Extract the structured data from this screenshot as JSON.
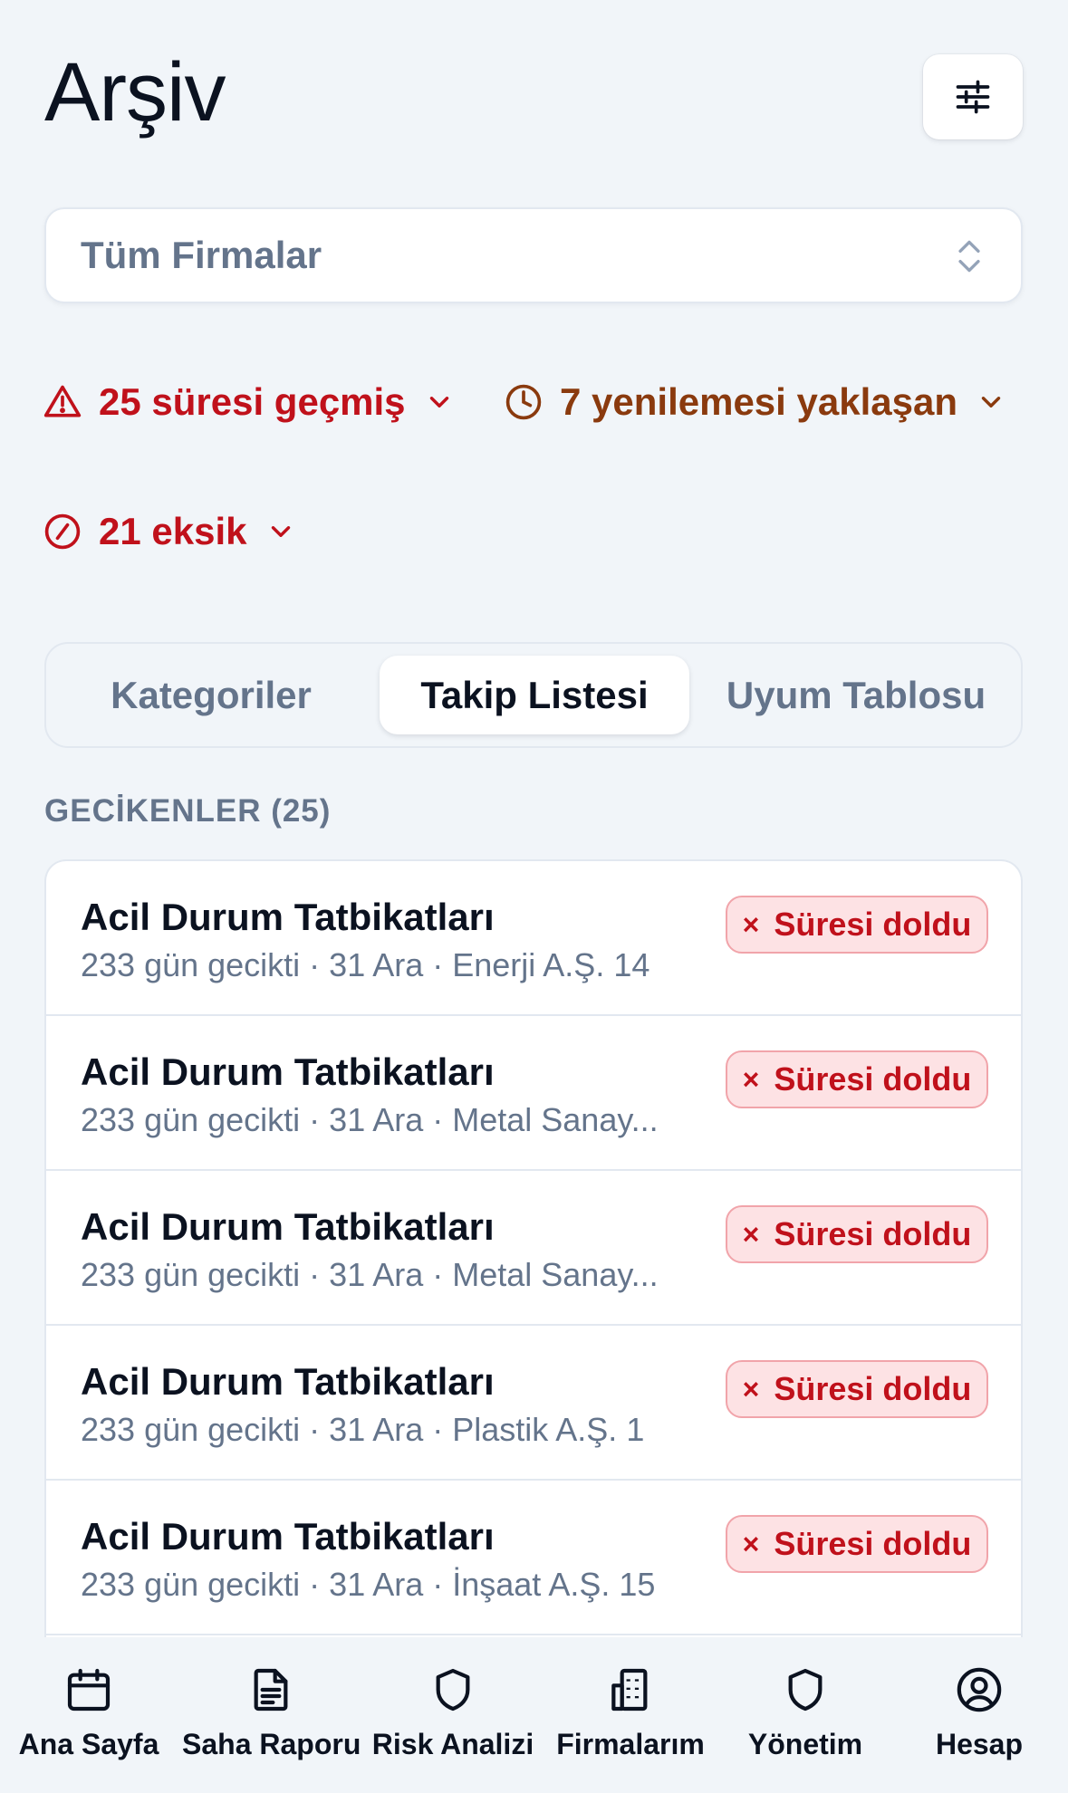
{
  "header": {
    "title": "Arşiv",
    "filter_icon": "sliders-icon"
  },
  "company_select": {
    "value": "Tüm Firmalar",
    "icon": "chevron-up-down-icon"
  },
  "alerts": {
    "overdue": {
      "label": "25 süresi geçmiş",
      "icon": "warning-triangle-icon",
      "color": "#c0111b"
    },
    "upcoming": {
      "label": "7 yenilemesi yaklaşan",
      "icon": "clock-icon",
      "color": "#8a3a0e"
    },
    "missing": {
      "label": "21 eksik",
      "icon": "ban-icon",
      "color": "#c0111b"
    }
  },
  "tabs": [
    {
      "label": "Kategoriler",
      "active": false
    },
    {
      "label": "Takip Listesi",
      "active": true
    },
    {
      "label": "Uyum Tablosu",
      "active": false
    }
  ],
  "section": {
    "label": "GECİKENLER (25)"
  },
  "items": [
    {
      "title": "Acil Durum Tatbikatları",
      "subtitle": "233 gün gecikti · 31 Ara · Enerji A.Ş. 14",
      "badge": "Süresi doldu",
      "badge_icon": "×"
    },
    {
      "title": "Acil Durum Tatbikatları",
      "subtitle": "233 gün gecikti · 31 Ara · Metal Sanay...",
      "badge": "Süresi doldu",
      "badge_icon": "×"
    },
    {
      "title": "Acil Durum Tatbikatları",
      "subtitle": "233 gün gecikti · 31 Ara · Metal Sanay...",
      "badge": "Süresi doldu",
      "badge_icon": "×"
    },
    {
      "title": "Acil Durum Tatbikatları",
      "subtitle": "233 gün gecikti · 31 Ara · Plastik A.Ş. 1",
      "badge": "Süresi doldu",
      "badge_icon": "×"
    },
    {
      "title": "Acil Durum Tatbikatları",
      "subtitle": "233 gün gecikti · 31 Ara · İnşaat A.Ş. 15",
      "badge": "Süresi doldu",
      "badge_icon": "×"
    }
  ],
  "nav": [
    {
      "label": "Ana Sayfa",
      "icon": "calendar-icon"
    },
    {
      "label": "Saha Raporu",
      "icon": "document-icon"
    },
    {
      "label": "Risk Analizi",
      "icon": "shield-icon"
    },
    {
      "label": "Firmalarım",
      "icon": "building-icon"
    },
    {
      "label": "Yönetim",
      "icon": "shield-icon"
    },
    {
      "label": "Hesap",
      "icon": "user-circle-icon"
    }
  ]
}
